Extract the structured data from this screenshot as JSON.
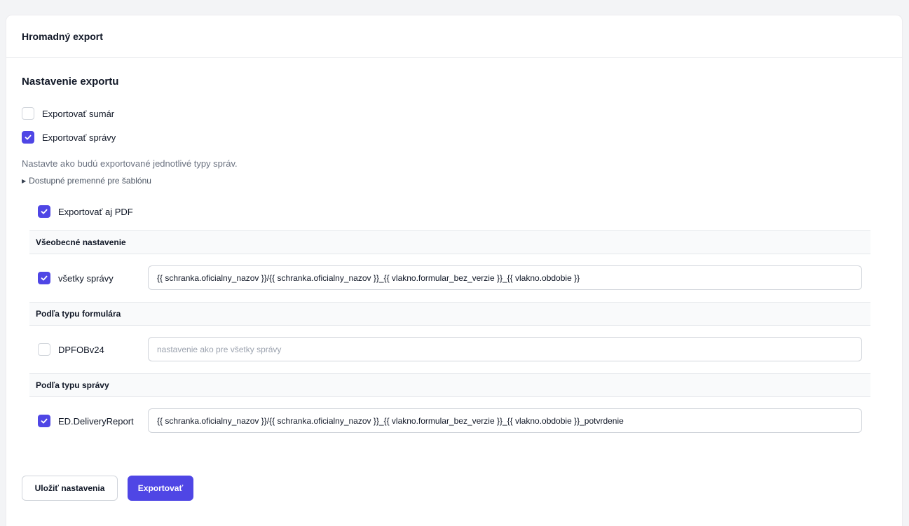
{
  "header": {
    "title": "Hromadný export"
  },
  "settings": {
    "title": "Nastavenie exportu",
    "export_summary": {
      "label": "Exportovať sumár",
      "checked": false
    },
    "export_messages": {
      "label": "Exportovať správy",
      "checked": true
    },
    "help_text": "Nastavte ako budú exportované jednotlivé typy správ.",
    "variables_toggle": "Dostupné premenné pre šablónu",
    "export_pdf": {
      "label": "Exportovať aj PDF",
      "checked": true
    }
  },
  "general": {
    "heading": "Všeobecné nastavenie",
    "all_messages": {
      "label": "všetky správy",
      "checked": true,
      "value": "{{ schranka.oficialny_nazov }}/{{ schranka.oficialny_nazov }}_{{ vlakno.formular_bez_verzie }}_{{ vlakno.obdobie }}"
    }
  },
  "by_form": {
    "heading": "Podľa typu formulára",
    "dpfobv24": {
      "label": "DPFOBv24",
      "checked": false,
      "value": "",
      "placeholder": "nastavenie ako pre všetky správy"
    }
  },
  "by_message": {
    "heading": "Podľa typu správy",
    "delivery_report": {
      "label": "ED.DeliveryReport",
      "checked": true,
      "value": "{{ schranka.oficialny_nazov }}/{{ schranka.oficialny_nazov }}_{{ vlakno.formular_bez_verzie }}_{{ vlakno.obdobie }}_potvrdenie"
    }
  },
  "buttons": {
    "save": "Uložiť nastavenia",
    "export": "Exportovať"
  },
  "colors": {
    "accent": "#4f46e5"
  },
  "icons": {
    "checkbox_check": "check-icon",
    "disclosure": "triangle-right-icon"
  }
}
